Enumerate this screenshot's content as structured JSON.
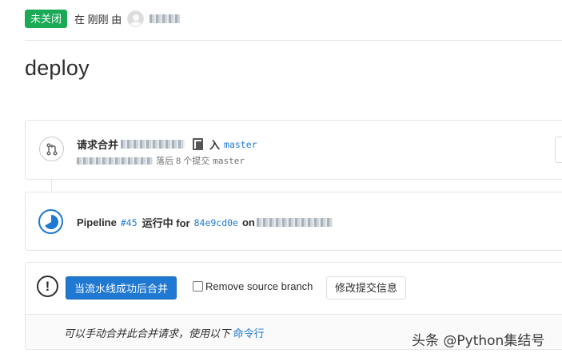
{
  "header": {
    "status": "未关闭",
    "time_prefix": "在 刚刚 由"
  },
  "page": {
    "title": "deploy"
  },
  "merge_request": {
    "label": "请求合并",
    "into": "入",
    "target_branch": "master",
    "behind_text": "落后 8 个提交",
    "behind_branch": "master"
  },
  "pipeline": {
    "label": "Pipeline",
    "id": "#45",
    "status": "运行中 for",
    "sha": "84e9cd0e",
    "on": "on"
  },
  "merge_widget": {
    "merge_button": "当流水线成功后合并",
    "remove_source_branch": "Remove source branch",
    "edit_commit_button": "修改提交信息",
    "footer_text": "可以手动合并此合并请求，使用以下",
    "footer_link": "命令行"
  },
  "watermark": "头条 @Python集结号",
  "colors": {
    "status_green": "#1aaa55",
    "link_blue": "#1f78d1",
    "border": "#e5e5e5"
  },
  "icons": {
    "merge_request": "merge-request-icon",
    "pipeline_running": "status-running-icon",
    "warning": "exclamation-icon",
    "copy": "copy-icon"
  }
}
